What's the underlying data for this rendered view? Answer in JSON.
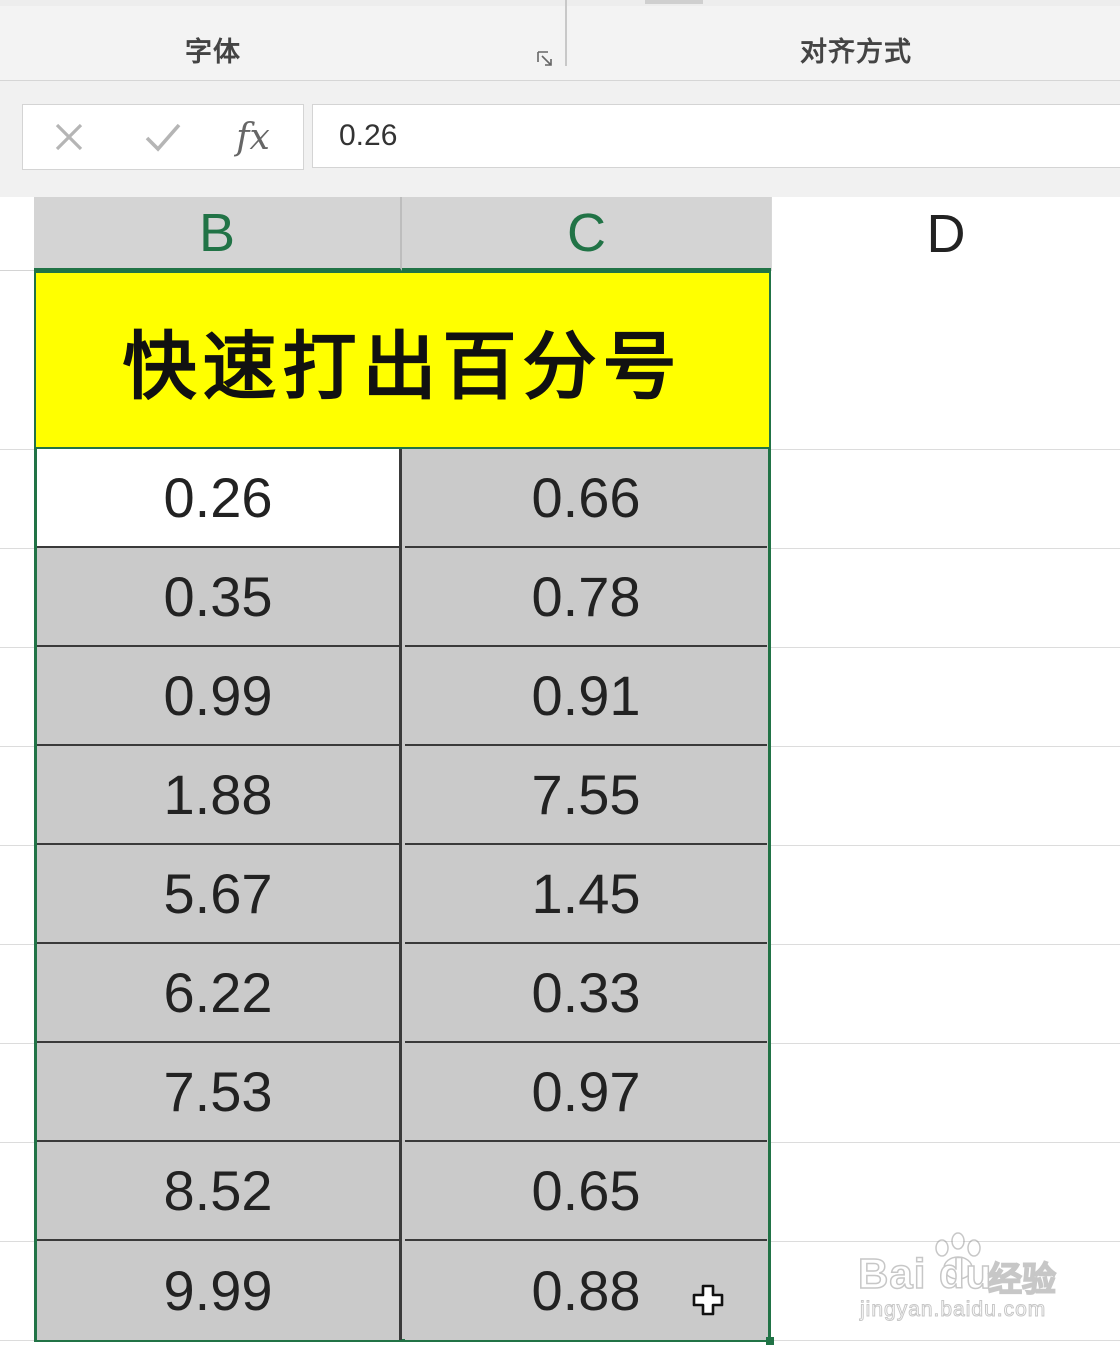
{
  "ribbon": {
    "groups": [
      {
        "label": "字体"
      },
      {
        "label": "对齐方式"
      }
    ]
  },
  "formula_bar": {
    "cancel_icon": "close-x-icon",
    "enter_icon": "checkmark-icon",
    "function_label": "fx",
    "value": "0.26"
  },
  "columns": [
    "B",
    "C",
    "D"
  ],
  "sheet": {
    "title": "快速打出百分号",
    "title_fill": "#ffff00",
    "selection_border_color": "#217346",
    "rows": [
      {
        "b": "0.26",
        "c": "0.66"
      },
      {
        "b": "0.35",
        "c": "0.78"
      },
      {
        "b": "0.99",
        "c": "0.91"
      },
      {
        "b": "1.88",
        "c": "7.55"
      },
      {
        "b": "5.67",
        "c": "1.45"
      },
      {
        "b": "6.22",
        "c": "0.33"
      },
      {
        "b": "7.53",
        "c": "0.97"
      },
      {
        "b": "8.52",
        "c": "0.65"
      },
      {
        "b": "9.99",
        "c": "0.88"
      }
    ]
  },
  "cursor": {
    "icon": "white-cross-cursor-icon"
  },
  "watermark": {
    "logo": "Bai du",
    "cn": "经验",
    "sub": "jingyan.baidu.com"
  }
}
